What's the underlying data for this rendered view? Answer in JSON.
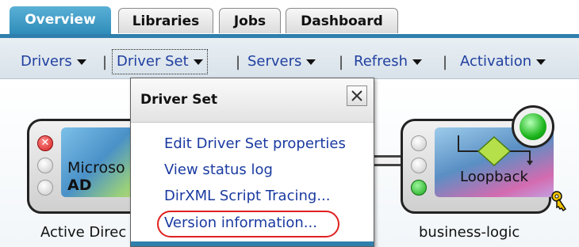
{
  "tabs": [
    {
      "label": "Overview",
      "active": true
    },
    {
      "label": "Libraries",
      "active": false
    },
    {
      "label": "Jobs",
      "active": false
    },
    {
      "label": "Dashboard",
      "active": false
    }
  ],
  "actionbar": {
    "menus": [
      {
        "label": "Drivers"
      },
      {
        "label": "Driver Set"
      },
      {
        "label": "Servers"
      },
      {
        "label": "Refresh"
      },
      {
        "label": "Activation"
      }
    ],
    "separator": "|"
  },
  "popup": {
    "title": "Driver Set",
    "items": [
      "Edit Driver Set properties",
      "View status log",
      "DirXML Script Tracing...",
      "Version information..."
    ],
    "highlighted_item": "Version information..."
  },
  "drivers": {
    "active_directory": {
      "image_text_line1": "Microso",
      "image_text_line2": "AD",
      "label": "Active Direc",
      "status_top": "error"
    },
    "loopback": {
      "image_text": "Loopback",
      "label": "business-logic",
      "status_bottom": "running"
    }
  },
  "colors": {
    "tab_active": "#2e8bb8",
    "link": "#1a3aa0",
    "highlight_oval": "#e02020",
    "status_green": "#1cb51c",
    "status_red": "#d32020"
  },
  "icons": [
    "caret-down-icon",
    "close-icon",
    "status-error-icon",
    "status-running-icon",
    "key-icon"
  ]
}
